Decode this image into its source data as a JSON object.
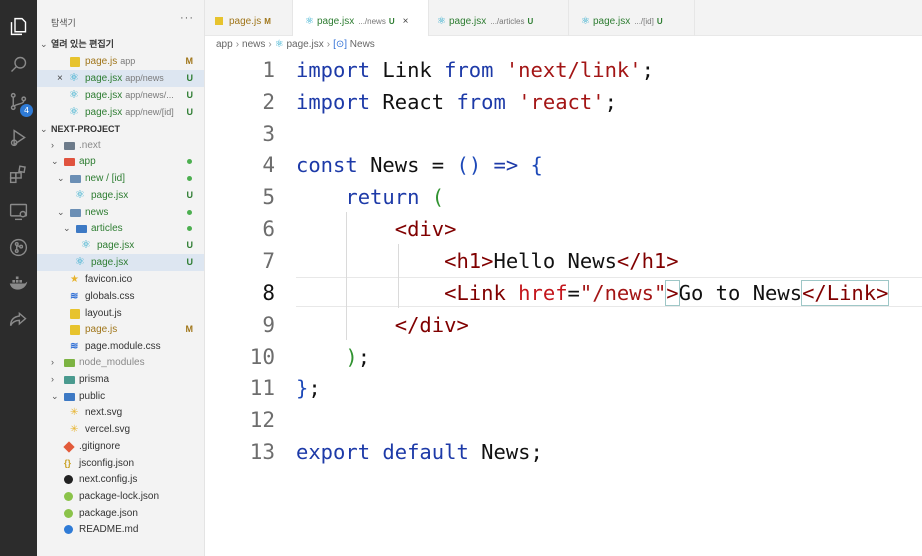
{
  "activity_bar": {
    "icons": [
      "explorer-icon",
      "search-icon",
      "source-control-icon",
      "run-debug-icon",
      "extensions-icon",
      "remote-explorer-icon",
      "git-graph-icon",
      "docker-icon",
      "live-share-icon"
    ],
    "source_control_badge": "4"
  },
  "sidebar": {
    "title": "탐색기",
    "more": "···",
    "open_editors_label": "열려 있는 편집기",
    "open_editors": [
      {
        "name": "page.js",
        "path": "app",
        "status": "M"
      },
      {
        "close": "×",
        "name": "page.jsx",
        "path": "app/news",
        "status": "U"
      },
      {
        "name": "page.jsx",
        "path": "app/news/...",
        "status": "U"
      },
      {
        "name": "page.jsx",
        "path": "app/new/[id]",
        "status": "U"
      }
    ],
    "project_label": "NEXT-PROJECT",
    "tree": [
      {
        "name": ".next"
      },
      {
        "name": "app"
      },
      {
        "name": "new / [id]"
      },
      {
        "name": "page.jsx",
        "status": "U"
      },
      {
        "name": "news"
      },
      {
        "name": "articles"
      },
      {
        "name": "page.jsx",
        "status": "U"
      },
      {
        "name": "page.jsx",
        "status": "U"
      },
      {
        "name": "favicon.ico"
      },
      {
        "name": "globals.css"
      },
      {
        "name": "layout.js"
      },
      {
        "name": "page.js",
        "status": "M"
      },
      {
        "name": "page.module.css"
      },
      {
        "name": "node_modules"
      },
      {
        "name": "prisma"
      },
      {
        "name": "public"
      },
      {
        "name": "next.svg"
      },
      {
        "name": "vercel.svg"
      },
      {
        "name": ".gitignore"
      },
      {
        "name": "jsconfig.json"
      },
      {
        "name": "next.config.js"
      },
      {
        "name": "package-lock.json"
      },
      {
        "name": "package.json"
      },
      {
        "name": "README.md"
      }
    ]
  },
  "tabs": [
    {
      "name": "page.js",
      "sub": "",
      "status": "M"
    },
    {
      "name": "page.jsx",
      "sub": ".../news",
      "status": "U",
      "close": "×"
    },
    {
      "name": "page.jsx",
      "sub": ".../articles",
      "status": "U"
    },
    {
      "name": "page.jsx",
      "sub": ".../[id]",
      "status": "U"
    }
  ],
  "breadcrumb": [
    "app",
    "news",
    "page.jsx",
    "News"
  ],
  "editor": {
    "line_numbers": [
      "1",
      "2",
      "3",
      "4",
      "5",
      "6",
      "7",
      "8",
      "9",
      "10",
      "11",
      "12",
      "13"
    ],
    "current_line": "8",
    "tokens": {
      "import1": "import",
      "link": "Link",
      "from1": "from",
      "str_link": "'next/link'",
      "semi": ";",
      "import2": "import",
      "react": "React",
      "from2": "from",
      "str_react": "'react'",
      "const": "const",
      "news_name": "News",
      "eq": "=",
      "paren_open": "(",
      "paren_close": ")",
      "arrow": "=>",
      "brace_open": "{",
      "return": "return",
      "return_paren": "(",
      "div_open": "<div>",
      "h1_open": "<h1>",
      "h1_text": "Hello News",
      "h1_close": "</h1>",
      "link_open": "<Link",
      "href": "href",
      "href_eq": "=",
      "href_val": "\"/news\"",
      "gt": ">",
      "link_text": "Go to News",
      "link_close": "</Link>",
      "div_close": "</div>",
      "close_paren": ")",
      "close_semi": ";",
      "brace_close": "}",
      "brace_semi": ";",
      "export": "export",
      "default": "default",
      "news_export": "News"
    }
  }
}
